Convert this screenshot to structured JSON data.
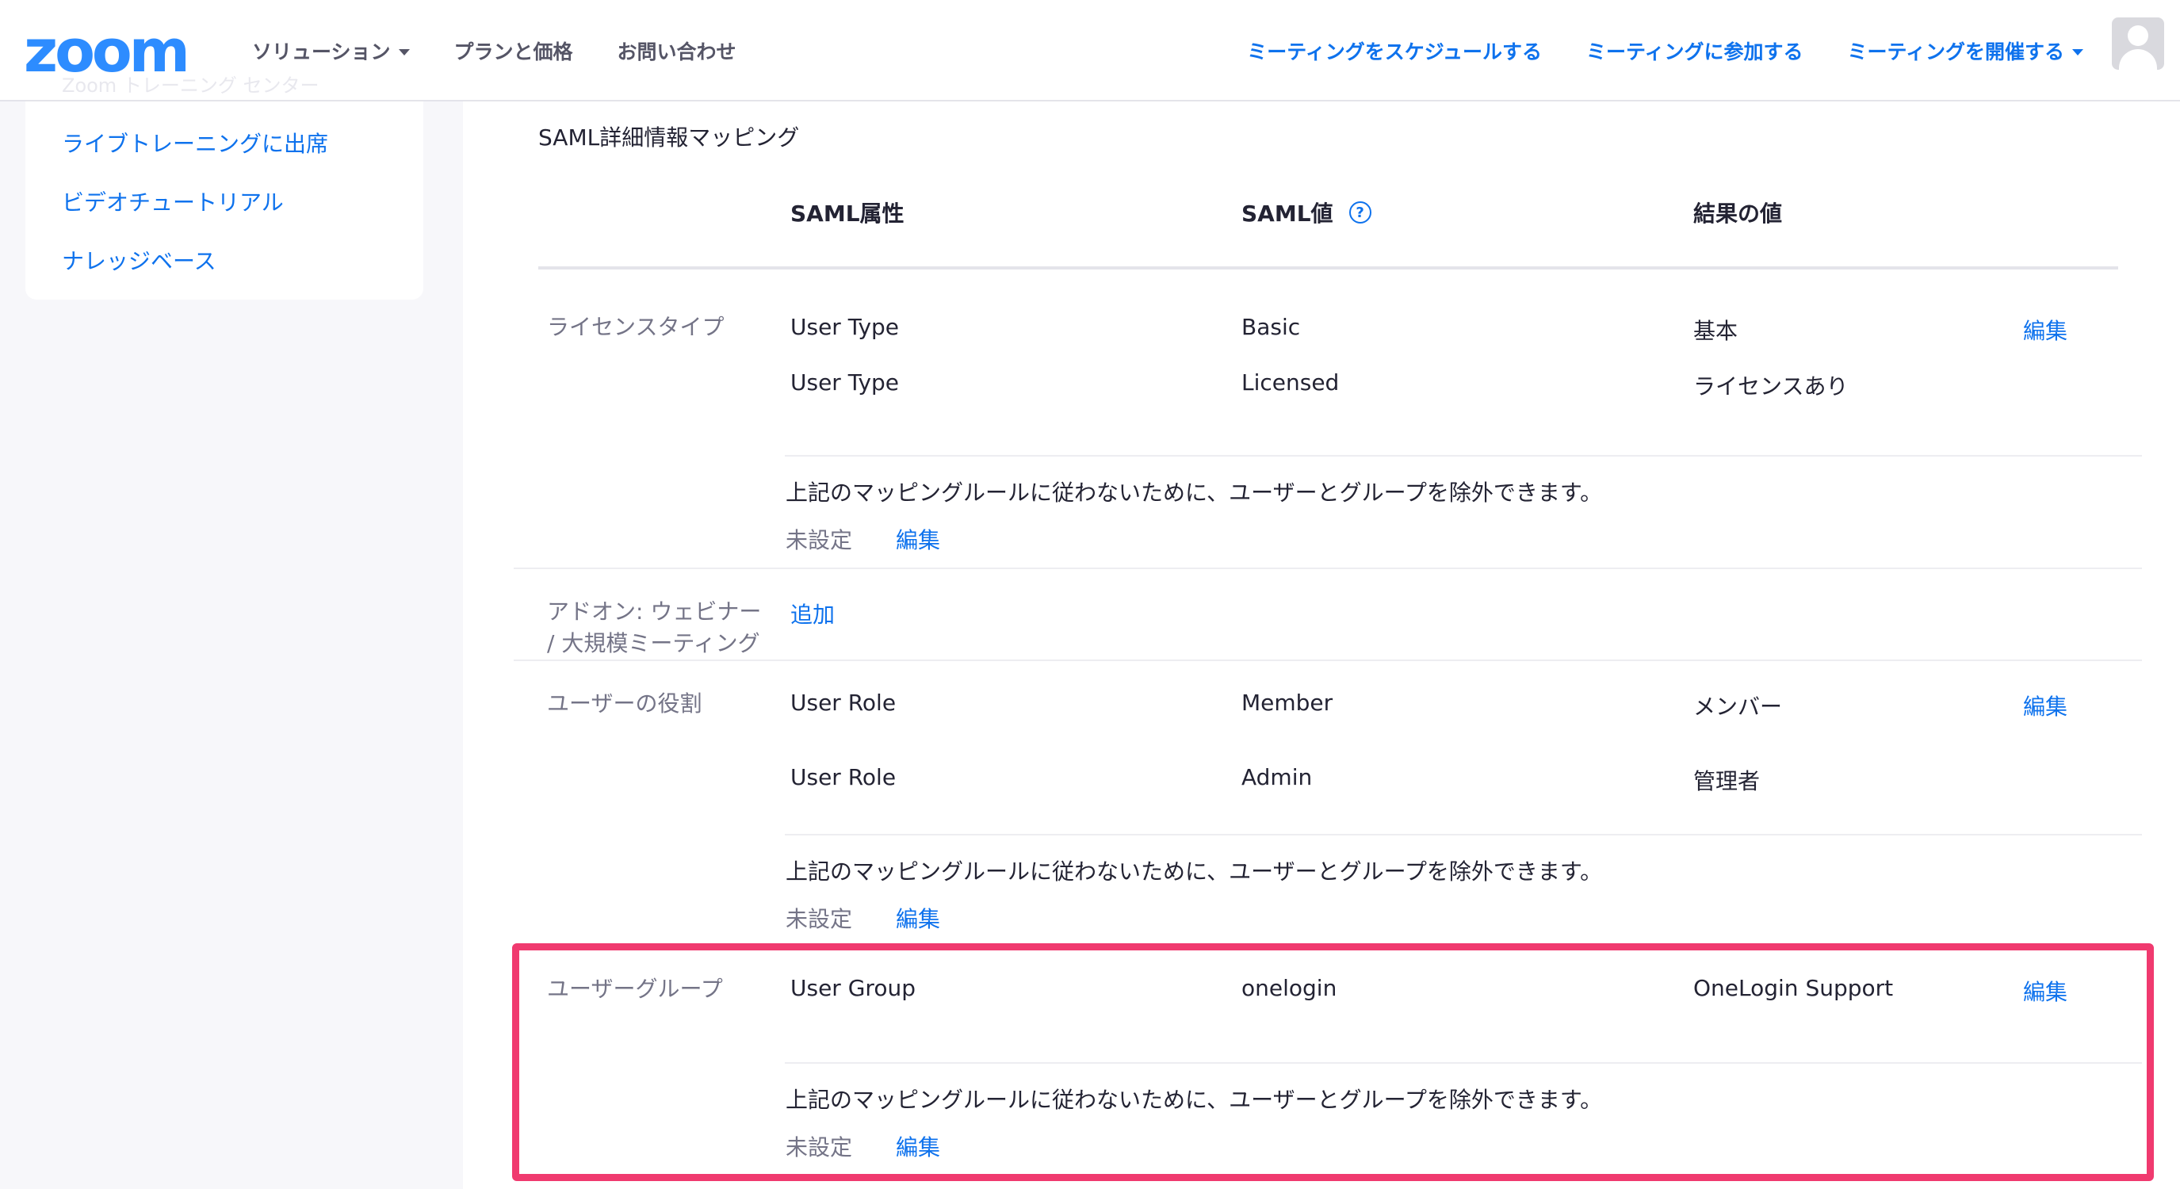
{
  "header": {
    "logo": "zoom",
    "nav_left": [
      "ソリューション",
      "プランと価格",
      "お問い合わせ"
    ],
    "nav_right": [
      "ミーティングをスケジュールする",
      "ミーティングに参加する",
      "ミーティングを開催する"
    ]
  },
  "sidebar": {
    "ghost_text": "Zoom トレーニング センター",
    "links": [
      "ライブトレーニングに出席",
      "ビデオチュートリアル",
      "ナレッジベース"
    ]
  },
  "main": {
    "section_title": "SAML詳細情報マッピング",
    "columns": [
      "SAML属性",
      "SAML値",
      "結果の値"
    ],
    "help_icon_glyph": "?",
    "license": {
      "label": "ライセンスタイプ",
      "rows": [
        {
          "attr": "User Type",
          "value": "Basic",
          "result": "基本",
          "action": "編集"
        },
        {
          "attr": "User Type",
          "value": "Licensed",
          "result": "ライセンスあり"
        }
      ],
      "exclude_note": "上記のマッピングルールに従わないために、ユーザーとグループを除外できます。",
      "status": "未設定",
      "edit": "編集"
    },
    "addon": {
      "label_line1": "アドオン: ウェビナー",
      "label_line2": "/ 大規模ミーティング",
      "add": "追加"
    },
    "role": {
      "label": "ユーザーの役割",
      "rows": [
        {
          "attr": "User Role",
          "value": "Member",
          "result": "メンバー",
          "action": "編集"
        },
        {
          "attr": "User Role",
          "value": "Admin",
          "result": "管理者"
        }
      ],
      "exclude_note": "上記のマッピングルールに従わないために、ユーザーとグループを除外できます。",
      "status": "未設定",
      "edit": "編集"
    },
    "group": {
      "label": "ユーザーグループ",
      "rows": [
        {
          "attr": "User Group",
          "value": "onelogin",
          "result": "OneLogin Support",
          "action": "編集"
        }
      ],
      "exclude_note": "上記のマッピングルールに従わないために、ユーザーとグループを除外できます。",
      "status": "未設定",
      "edit": "編集"
    }
  },
  "colors": {
    "brand_blue": "#2d8cff",
    "link_blue": "#0e72ed",
    "highlight": "#f03a6f"
  }
}
